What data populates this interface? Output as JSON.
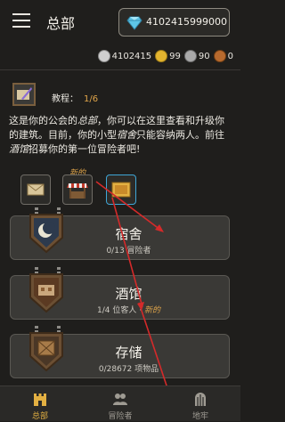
{
  "header": {
    "title": "总部",
    "gems_value": "4102415999000"
  },
  "currencies": [
    {
      "icon": "crown-coin-icon",
      "value": "4102415"
    },
    {
      "icon": "gold-coin-icon",
      "value": "99"
    },
    {
      "icon": "silver-coin-icon",
      "value": "90"
    },
    {
      "icon": "copper-coin-icon",
      "value": "0"
    }
  ],
  "tutorial": {
    "label": "教程：",
    "progress": "1/6",
    "text_parts": [
      "这是你的公会的",
      "总部",
      "，你可以在这里查看和升级你的建筑。目前，你的小型",
      "宿舍",
      "只能容纳两人。前往",
      "酒馆",
      "招募你的第一位冒险者吧!"
    ]
  },
  "quick_actions": {
    "new_tag": "新的"
  },
  "buildings": [
    {
      "name": "宿舍",
      "sub": "0/13 冒险者",
      "new": ""
    },
    {
      "name": "酒馆",
      "sub": "1/4 位客人 · ",
      "new": "新的"
    },
    {
      "name": "存储",
      "sub": "0/28672 项物品",
      "new": ""
    }
  ],
  "nav": [
    {
      "label": "总部",
      "icon": "castle-icon",
      "active": true
    },
    {
      "label": "冒险者",
      "icon": "people-icon",
      "active": false
    },
    {
      "label": "地牢",
      "icon": "dungeon-gate-icon",
      "active": false
    }
  ],
  "colors": {
    "accent": "#e0a54a",
    "arrow": "#d42a2a"
  }
}
